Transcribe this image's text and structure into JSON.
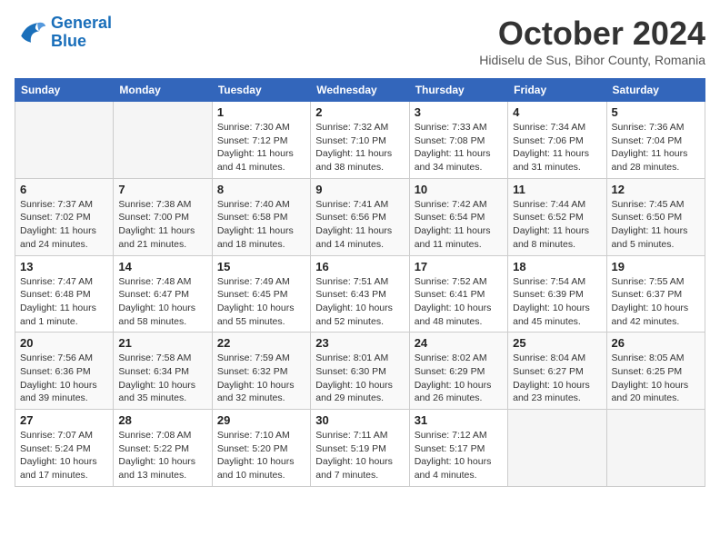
{
  "logo": {
    "line1": "General",
    "line2": "Blue"
  },
  "calendar": {
    "title": "October 2024",
    "subtitle": "Hidiselu de Sus, Bihor County, Romania"
  },
  "headers": [
    "Sunday",
    "Monday",
    "Tuesday",
    "Wednesday",
    "Thursday",
    "Friday",
    "Saturday"
  ],
  "weeks": [
    [
      {
        "day": "",
        "info": ""
      },
      {
        "day": "",
        "info": ""
      },
      {
        "day": "1",
        "info": "Sunrise: 7:30 AM\nSunset: 7:12 PM\nDaylight: 11 hours and 41 minutes."
      },
      {
        "day": "2",
        "info": "Sunrise: 7:32 AM\nSunset: 7:10 PM\nDaylight: 11 hours and 38 minutes."
      },
      {
        "day": "3",
        "info": "Sunrise: 7:33 AM\nSunset: 7:08 PM\nDaylight: 11 hours and 34 minutes."
      },
      {
        "day": "4",
        "info": "Sunrise: 7:34 AM\nSunset: 7:06 PM\nDaylight: 11 hours and 31 minutes."
      },
      {
        "day": "5",
        "info": "Sunrise: 7:36 AM\nSunset: 7:04 PM\nDaylight: 11 hours and 28 minutes."
      }
    ],
    [
      {
        "day": "6",
        "info": "Sunrise: 7:37 AM\nSunset: 7:02 PM\nDaylight: 11 hours and 24 minutes."
      },
      {
        "day": "7",
        "info": "Sunrise: 7:38 AM\nSunset: 7:00 PM\nDaylight: 11 hours and 21 minutes."
      },
      {
        "day": "8",
        "info": "Sunrise: 7:40 AM\nSunset: 6:58 PM\nDaylight: 11 hours and 18 minutes."
      },
      {
        "day": "9",
        "info": "Sunrise: 7:41 AM\nSunset: 6:56 PM\nDaylight: 11 hours and 14 minutes."
      },
      {
        "day": "10",
        "info": "Sunrise: 7:42 AM\nSunset: 6:54 PM\nDaylight: 11 hours and 11 minutes."
      },
      {
        "day": "11",
        "info": "Sunrise: 7:44 AM\nSunset: 6:52 PM\nDaylight: 11 hours and 8 minutes."
      },
      {
        "day": "12",
        "info": "Sunrise: 7:45 AM\nSunset: 6:50 PM\nDaylight: 11 hours and 5 minutes."
      }
    ],
    [
      {
        "day": "13",
        "info": "Sunrise: 7:47 AM\nSunset: 6:48 PM\nDaylight: 11 hours and 1 minute."
      },
      {
        "day": "14",
        "info": "Sunrise: 7:48 AM\nSunset: 6:47 PM\nDaylight: 10 hours and 58 minutes."
      },
      {
        "day": "15",
        "info": "Sunrise: 7:49 AM\nSunset: 6:45 PM\nDaylight: 10 hours and 55 minutes."
      },
      {
        "day": "16",
        "info": "Sunrise: 7:51 AM\nSunset: 6:43 PM\nDaylight: 10 hours and 52 minutes."
      },
      {
        "day": "17",
        "info": "Sunrise: 7:52 AM\nSunset: 6:41 PM\nDaylight: 10 hours and 48 minutes."
      },
      {
        "day": "18",
        "info": "Sunrise: 7:54 AM\nSunset: 6:39 PM\nDaylight: 10 hours and 45 minutes."
      },
      {
        "day": "19",
        "info": "Sunrise: 7:55 AM\nSunset: 6:37 PM\nDaylight: 10 hours and 42 minutes."
      }
    ],
    [
      {
        "day": "20",
        "info": "Sunrise: 7:56 AM\nSunset: 6:36 PM\nDaylight: 10 hours and 39 minutes."
      },
      {
        "day": "21",
        "info": "Sunrise: 7:58 AM\nSunset: 6:34 PM\nDaylight: 10 hours and 35 minutes."
      },
      {
        "day": "22",
        "info": "Sunrise: 7:59 AM\nSunset: 6:32 PM\nDaylight: 10 hours and 32 minutes."
      },
      {
        "day": "23",
        "info": "Sunrise: 8:01 AM\nSunset: 6:30 PM\nDaylight: 10 hours and 29 minutes."
      },
      {
        "day": "24",
        "info": "Sunrise: 8:02 AM\nSunset: 6:29 PM\nDaylight: 10 hours and 26 minutes."
      },
      {
        "day": "25",
        "info": "Sunrise: 8:04 AM\nSunset: 6:27 PM\nDaylight: 10 hours and 23 minutes."
      },
      {
        "day": "26",
        "info": "Sunrise: 8:05 AM\nSunset: 6:25 PM\nDaylight: 10 hours and 20 minutes."
      }
    ],
    [
      {
        "day": "27",
        "info": "Sunrise: 7:07 AM\nSunset: 5:24 PM\nDaylight: 10 hours and 17 minutes."
      },
      {
        "day": "28",
        "info": "Sunrise: 7:08 AM\nSunset: 5:22 PM\nDaylight: 10 hours and 13 minutes."
      },
      {
        "day": "29",
        "info": "Sunrise: 7:10 AM\nSunset: 5:20 PM\nDaylight: 10 hours and 10 minutes."
      },
      {
        "day": "30",
        "info": "Sunrise: 7:11 AM\nSunset: 5:19 PM\nDaylight: 10 hours and 7 minutes."
      },
      {
        "day": "31",
        "info": "Sunrise: 7:12 AM\nSunset: 5:17 PM\nDaylight: 10 hours and 4 minutes."
      },
      {
        "day": "",
        "info": ""
      },
      {
        "day": "",
        "info": ""
      }
    ]
  ]
}
